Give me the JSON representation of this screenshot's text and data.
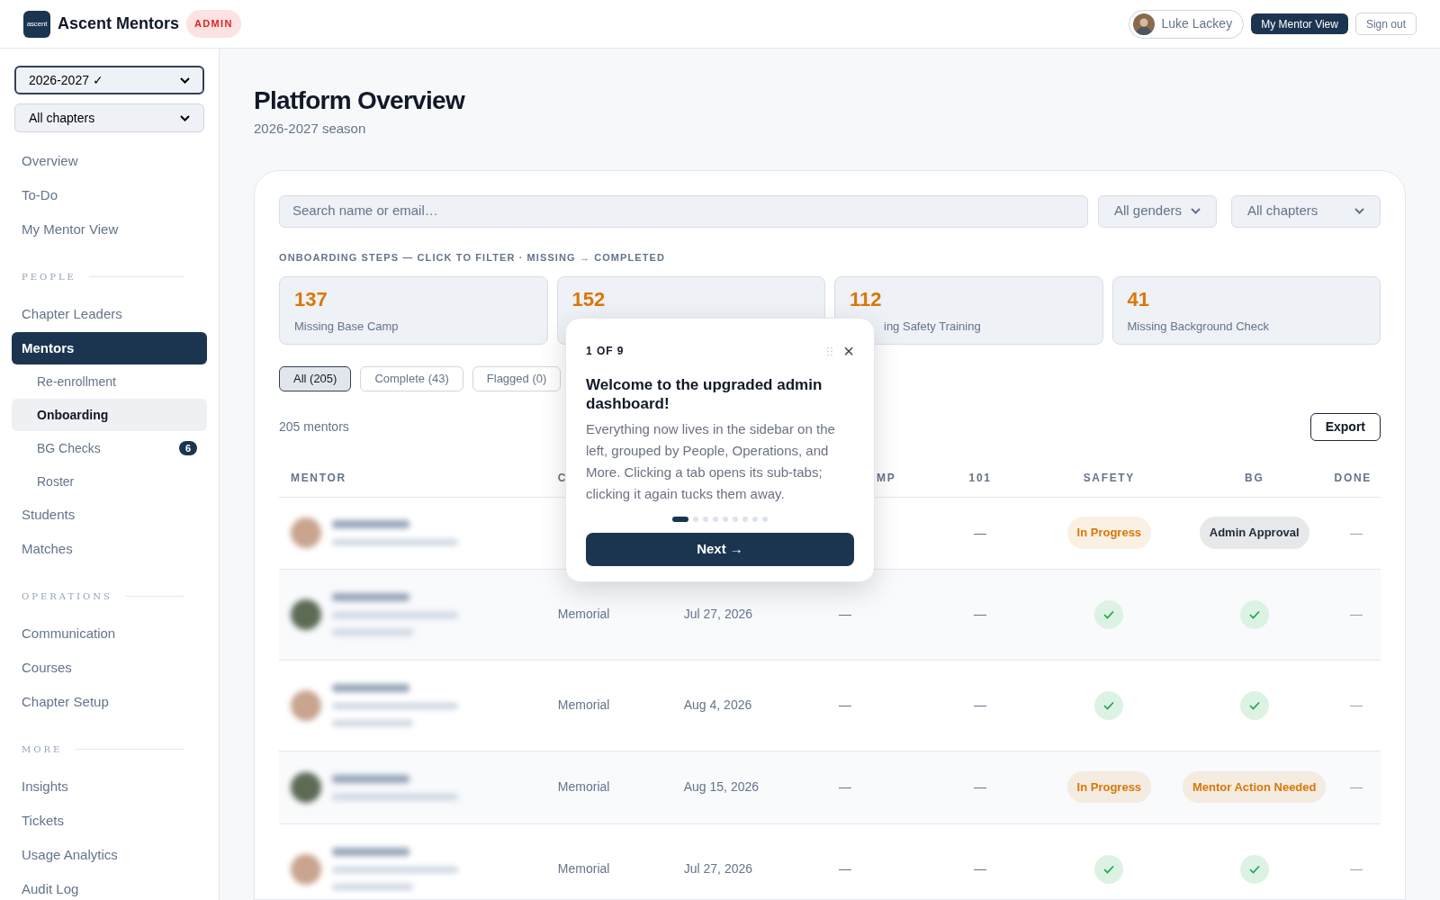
{
  "header": {
    "logo_text": "ascent",
    "brand": "Ascent Mentors",
    "role_badge": "ADMIN",
    "user": "Luke Lackey",
    "mentor_view_button": "My Mentor View",
    "sign_out_button": "Sign out"
  },
  "sidebar": {
    "season_select": "2026-2027 ✓",
    "chapter_select": "All chapters",
    "sections": [
      {
        "items": [
          {
            "label": "Overview",
            "selected": false
          },
          {
            "label": "To-Do",
            "selected": false
          },
          {
            "label": "My Mentor View",
            "selected": false
          }
        ]
      },
      {
        "heading": "PEOPLE",
        "items": [
          {
            "label": "Chapter Leaders",
            "selected": false
          },
          {
            "label": "Mentors",
            "selected": true,
            "children": [
              {
                "label": "Re-enrollment",
                "selected": false
              },
              {
                "label": "Onboarding",
                "selected": true
              },
              {
                "label": "BG Checks",
                "selected": false,
                "badge": "6"
              },
              {
                "label": "Roster",
                "selected": false
              }
            ]
          },
          {
            "label": "Students",
            "selected": false
          },
          {
            "label": "Matches",
            "selected": false
          }
        ]
      },
      {
        "heading": "OPERATIONS",
        "items": [
          {
            "label": "Communication",
            "selected": false
          },
          {
            "label": "Courses",
            "selected": false
          },
          {
            "label": "Chapter Setup",
            "selected": false
          }
        ]
      },
      {
        "heading": "MORE",
        "items": [
          {
            "label": "Insights",
            "selected": false
          },
          {
            "label": "Tickets",
            "selected": false
          },
          {
            "label": "Usage Analytics",
            "selected": false
          },
          {
            "label": "Audit Log",
            "selected": false
          }
        ]
      }
    ]
  },
  "page": {
    "title": "Platform Overview",
    "subtitle": "2026-2027 season"
  },
  "filters": {
    "search_placeholder": "Search name or email…",
    "gender_select": "All genders",
    "chapter_select": "All chapters"
  },
  "steps_label": "ONBOARDING STEPS — CLICK TO FILTER · MISSING → COMPLETED",
  "step_cards": [
    {
      "count": "137",
      "label": "Missing Base Camp"
    },
    {
      "count": "152"
    },
    {
      "count": "112",
      "label": "ing Safety Training"
    },
    {
      "count": "41",
      "label": "Missing Background Check"
    }
  ],
  "status_tabs": [
    {
      "label": "All (205)",
      "selected": true
    },
    {
      "label": "Complete (43)",
      "selected": false
    },
    {
      "label": "Flagged (0)",
      "selected": false
    }
  ],
  "mentor_count": "205 mentors",
  "export_button": "Export",
  "table": {
    "columns": [
      {
        "label": "MENTOR"
      },
      {
        "label": "C"
      },
      {},
      {
        "label": "MP"
      },
      {
        "label": "101"
      },
      {
        "label": "SAFETY"
      },
      {
        "label": "BG"
      },
      {
        "label": "DONE"
      }
    ],
    "rows": [
      {
        "c101": "—",
        "safety": {
          "kind": "badge",
          "text": "In Progress",
          "color": "#d97706"
        },
        "bg": {
          "kind": "badge",
          "text": "Admin Approval",
          "color": "#1e293b"
        },
        "done": "—"
      },
      {
        "chapter": "Memorial",
        "date": "Jul 27, 2026",
        "base_camp": "—",
        "c101": "—",
        "safety": {
          "kind": "check"
        },
        "bg": {
          "kind": "check"
        },
        "done": "—"
      },
      {
        "chapter": "Memorial",
        "date": "Aug 4, 2026",
        "base_camp": "—",
        "c101": "—",
        "safety": {
          "kind": "check"
        },
        "bg": {
          "kind": "check"
        },
        "done": "—"
      },
      {
        "chapter": "Memorial",
        "date": "Aug 15, 2026",
        "base_camp": "—",
        "c101": "—",
        "safety": {
          "kind": "badge",
          "text": "In Progress",
          "color": "#d97706"
        },
        "bg": {
          "kind": "badge",
          "text": "Mentor Action Needed",
          "color": "#d97706"
        },
        "done": "—"
      },
      {
        "chapter": "Memorial",
        "date": "Jul 27, 2026",
        "base_camp": "—",
        "c101": "—",
        "safety": {
          "kind": "check"
        },
        "bg": {
          "kind": "check"
        },
        "done": "—"
      }
    ]
  },
  "tour": {
    "step": "1 OF 9",
    "title": "Welcome to the upgraded admin dashboard!",
    "body": "Everything now lives in the sidebar on the left, grouped by People, Operations, and More. Clicking a tab opens its sub-tabs; clicking it again tucks them away.",
    "dots": [
      {
        "selected": true
      },
      {
        "selected": false
      },
      {
        "selected": false
      },
      {
        "selected": false
      },
      {
        "selected": false
      },
      {
        "selected": false
      },
      {
        "selected": false
      },
      {
        "selected": false
      },
      {
        "selected": false
      }
    ],
    "close": "×",
    "next_button": "Next →"
  }
}
